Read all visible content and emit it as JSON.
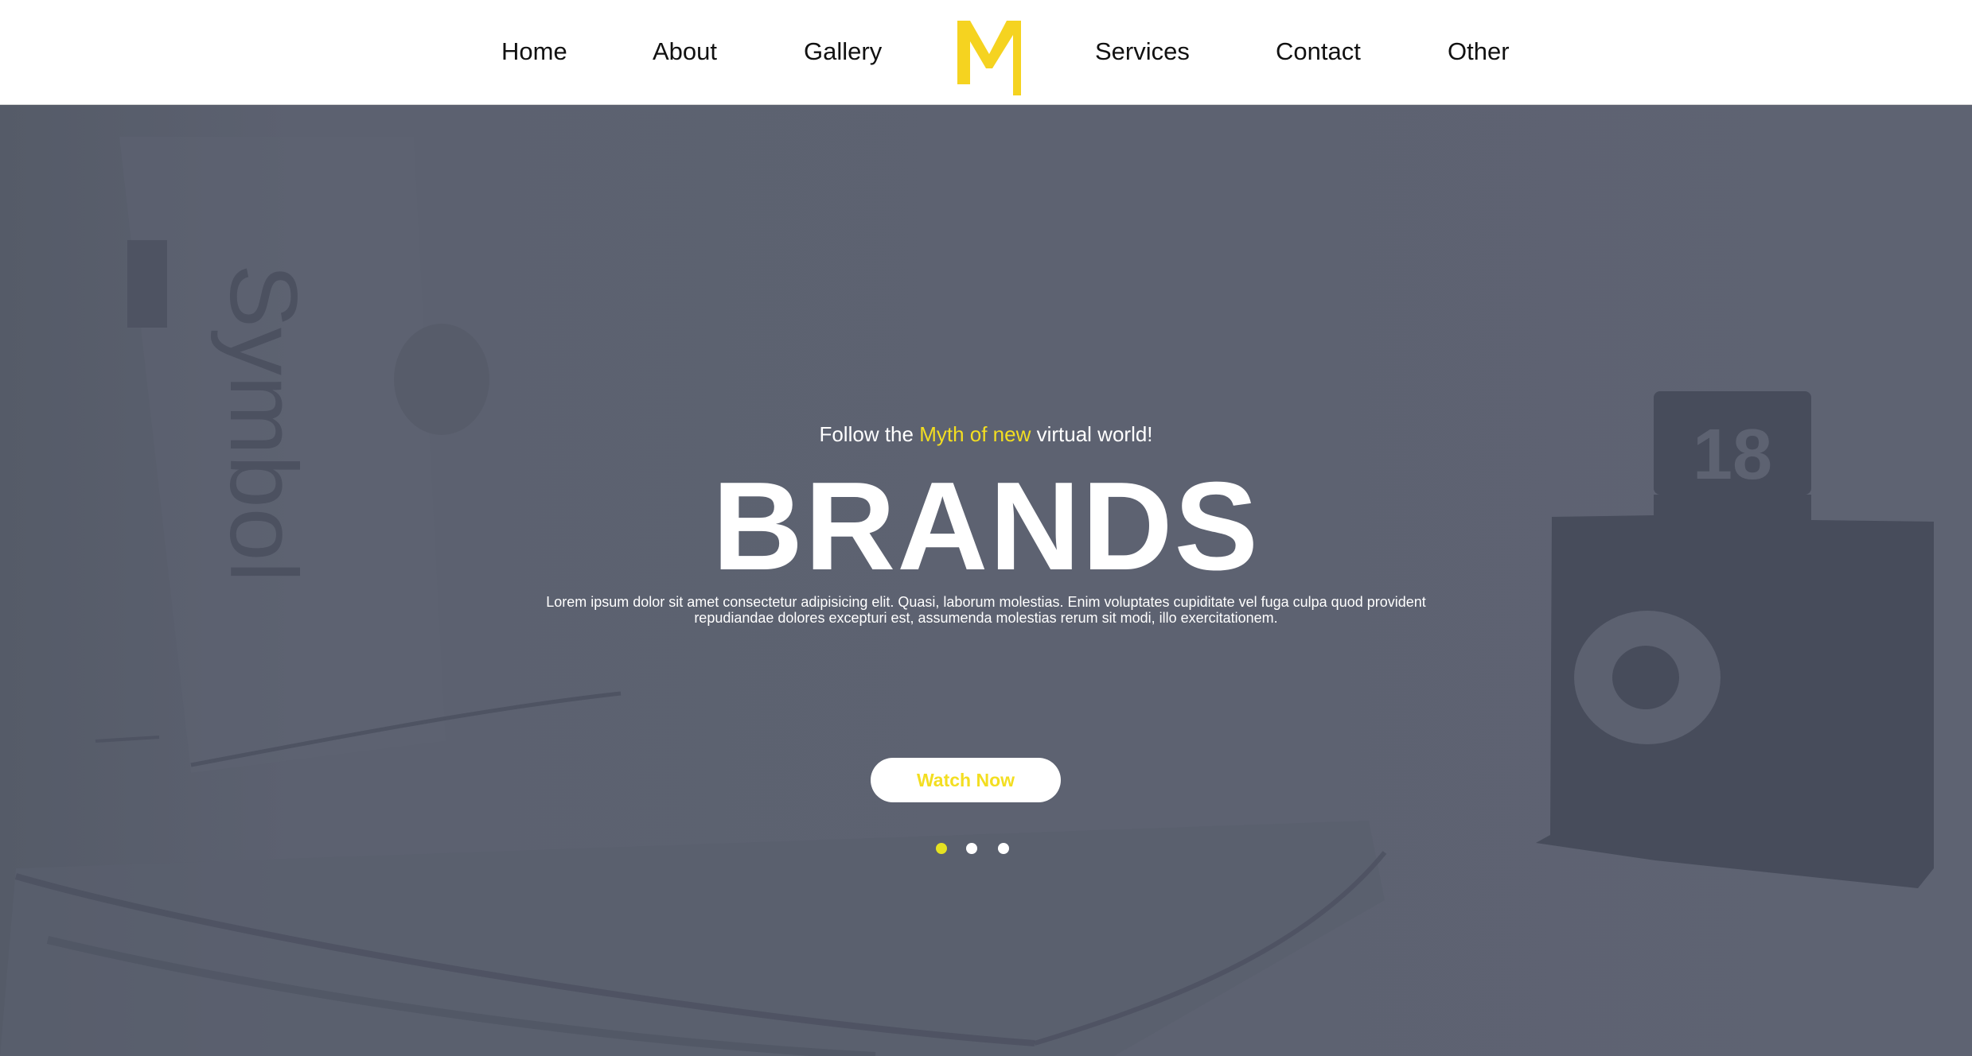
{
  "header": {
    "nav_left": [
      {
        "label": "Home"
      },
      {
        "label": "About"
      },
      {
        "label": "Gallery"
      }
    ],
    "logo": {
      "letter": "M",
      "color": "#f5d320"
    },
    "nav_right": [
      {
        "label": "Services"
      },
      {
        "label": "Contact"
      },
      {
        "label": "Other"
      }
    ]
  },
  "hero": {
    "tagline_prefix": "Follow the ",
    "tagline_highlight": "Myth of new",
    "tagline_suffix": " virtual world!",
    "headline": "BRANDS",
    "description": "Lorem ipsum dolor sit amet consectetur adipisicing elit. Quasi, laborum molestias. Enim voluptates cupiditate vel fuga culpa quod provident repudiandae dolores excepturi est, assumenda molestias rerum sit modi, illo exercitationem.",
    "cta_label": "Watch Now",
    "background_image": {
      "book_text": "Symbol",
      "calendar_number": "18"
    },
    "slider": {
      "total_slides": 3,
      "active_index": 0
    }
  },
  "colors": {
    "accent": "#f3de21",
    "hero_overlay": "#5c6170",
    "header_bg": "#ffffff",
    "nav_text": "#111111"
  }
}
